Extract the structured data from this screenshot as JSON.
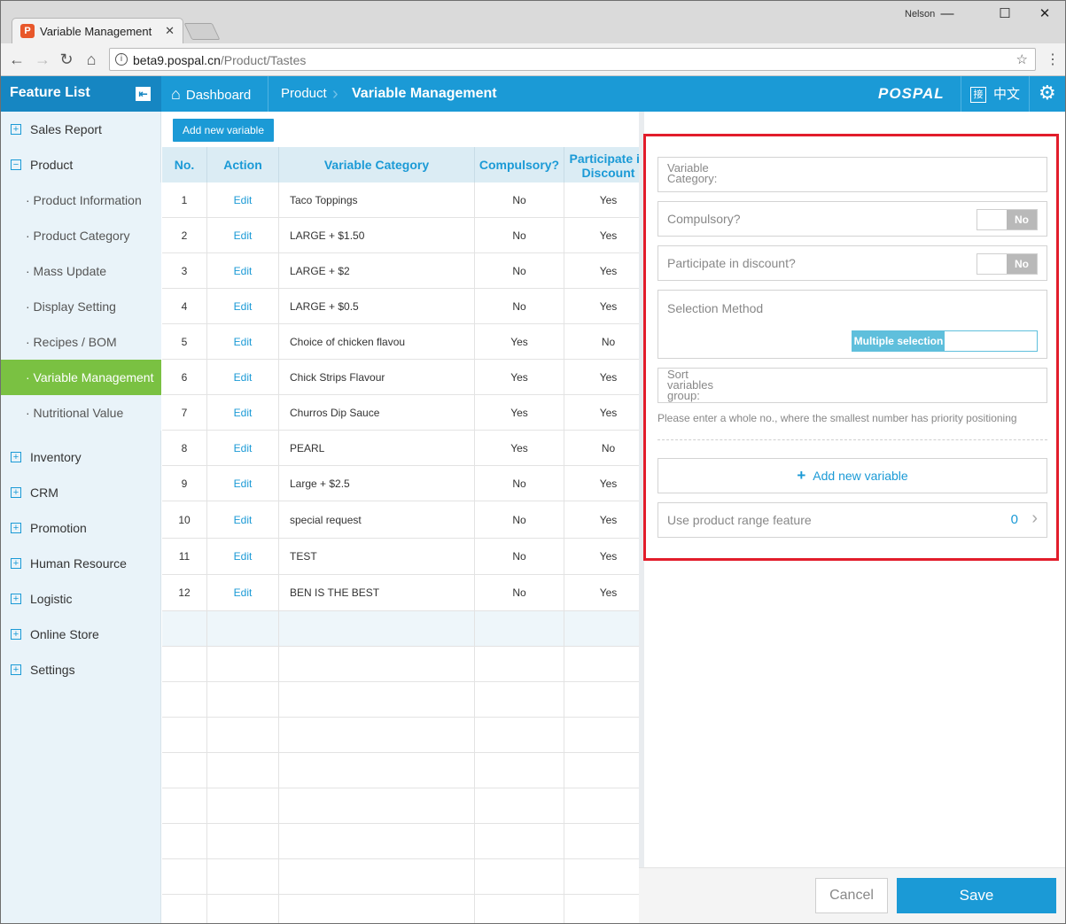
{
  "browser": {
    "tab_title": "Variable Management",
    "tab_close": "✕",
    "user": "Nelson",
    "url_host": "beta9.pospal.cn",
    "url_path": "/Product/Tastes"
  },
  "header": {
    "feature_list": "Feature List",
    "crumbs": [
      "Dashboard",
      "Product",
      "Variable Management"
    ],
    "logo": "POSPAL",
    "lang": "中文",
    "lang_icon": "接"
  },
  "sidebar": {
    "items": [
      {
        "label": "Sales Report",
        "type": "group"
      },
      {
        "label": "Product",
        "type": "group-open"
      },
      {
        "label": "· Product Information",
        "type": "sub"
      },
      {
        "label": "· Product Category",
        "type": "sub"
      },
      {
        "label": "· Mass Update",
        "type": "sub"
      },
      {
        "label": "· Display Setting",
        "type": "sub"
      },
      {
        "label": "· Recipes / BOM",
        "type": "sub"
      },
      {
        "label": "· Variable Management",
        "type": "sub-active"
      },
      {
        "label": "· Nutritional Value",
        "type": "sub"
      },
      {
        "label": "Inventory",
        "type": "group"
      },
      {
        "label": "CRM",
        "type": "group"
      },
      {
        "label": "Promotion",
        "type": "group"
      },
      {
        "label": "Human Resource",
        "type": "group"
      },
      {
        "label": "Logistic",
        "type": "group"
      },
      {
        "label": "Online Store",
        "type": "group"
      },
      {
        "label": "Settings",
        "type": "group"
      }
    ]
  },
  "toolbar": {
    "add_label": "Add new variable"
  },
  "table": {
    "headers": [
      "No.",
      "Action",
      "Variable Category",
      "Compulsory?",
      "Participate in Discount"
    ],
    "rows": [
      [
        "1",
        "Edit",
        "Taco Toppings",
        "No",
        "Yes"
      ],
      [
        "2",
        "Edit",
        "LARGE + $1.50",
        "No",
        "Yes"
      ],
      [
        "3",
        "Edit",
        "LARGE + $2",
        "No",
        "Yes"
      ],
      [
        "4",
        "Edit",
        "LARGE + $0.5",
        "No",
        "Yes"
      ],
      [
        "5",
        "Edit",
        "Choice of chicken flavou",
        "Yes",
        "No"
      ],
      [
        "6",
        "Edit",
        "Chick Strips Flavour",
        "Yes",
        "Yes"
      ],
      [
        "7",
        "Edit",
        "Churros Dip Sauce",
        "Yes",
        "Yes"
      ],
      [
        "8",
        "Edit",
        "PEARL",
        "Yes",
        "No"
      ],
      [
        "9",
        "Edit",
        "Large + $2.5",
        "No",
        "Yes"
      ],
      [
        "10",
        "Edit",
        "special request",
        "No",
        "Yes"
      ],
      [
        "11",
        "Edit",
        "TEST",
        "No",
        "Yes"
      ],
      [
        "12",
        "Edit",
        "BEN IS THE BEST",
        "No",
        "Yes"
      ]
    ]
  },
  "form": {
    "category_label": "Variable Category:",
    "compulsory_label": "Compulsory?",
    "compulsory_value": "No",
    "discount_label": "Participate in discount?",
    "discount_value": "No",
    "selection_label": "Selection Method",
    "selection_value": "Multiple selection",
    "sort_label": "Sort variables group:",
    "sort_hint": "Please enter a whole no., where the smallest number has priority positioning",
    "add_variable": "Add new variable",
    "range_label": "Use product range feature",
    "range_count": "0",
    "cancel": "Cancel",
    "save": "Save"
  }
}
